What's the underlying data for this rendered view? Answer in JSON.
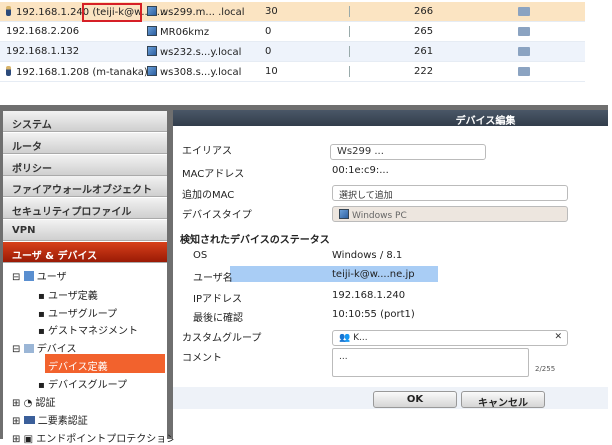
{
  "device_table": {
    "rows": [
      {
        "ip": "192.168.1.240",
        "user": "(teiji-k@w...o...",
        "user_icon": true,
        "host": "ws299.m... .local",
        "count1": "30",
        "count2": "266",
        "highlight": true
      },
      {
        "ip": "192.168.2.206",
        "user": "",
        "user_icon": false,
        "host": "MR06kmz",
        "count1": "0",
        "count2": "265"
      },
      {
        "ip": "192.168.1.132",
        "user": "",
        "user_icon": false,
        "host": "ws232.s...y.local",
        "count1": "0",
        "count2": "261"
      },
      {
        "ip": "192.168.1.208 (m-tanaka)",
        "user": "",
        "user_icon": true,
        "host": "ws308.s...y.local",
        "count1": "10",
        "count2": "222"
      }
    ]
  },
  "sidebar": {
    "menus": [
      "システム",
      "ルータ",
      "ポリシー",
      "ファイアウォールオブジェクト",
      "セキュリティプロファイル",
      "VPN",
      "ユーザ & デバイス"
    ],
    "tree": {
      "user": "ユーザ",
      "user_def": "ユーザ定義",
      "user_group": "ユーザグループ",
      "guest": "ゲストマネジメント",
      "device": "デバイス",
      "device_def": "デバイス定義",
      "device_group": "デバイスグループ",
      "auth": "認証",
      "two_factor": "二要素認証",
      "endpoint": "エンドポイントプロテクション"
    }
  },
  "dialog": {
    "title": "デバイス編集",
    "alias_label": "エイリアス",
    "alias_value": "Ws299 ...",
    "mac_label": "MACアドレス",
    "mac_value": "00:1e:c9:...",
    "addmac_label": "追加のMAC",
    "addmac_placeholder": "選択して追加",
    "type_label": "デバイスタイプ",
    "type_value": "Windows PC",
    "status_heading": "検知されたデバイスのステータス",
    "os_label": "OS",
    "os_value": "Windows / 8.1",
    "user_label": "ユーザ名",
    "user_value": "teiji-k@w....ne.jp",
    "ip_label": "IPアドレス",
    "ip_value": "192.168.1.240",
    "last_label": "最後に確認",
    "last_value": "10:10:55 (port1)",
    "group_label": "カスタムグループ",
    "group_value": "K...",
    "comment_label": "コメント",
    "comment_value": "...",
    "comment_count": "2/255",
    "ok": "OK",
    "cancel": "キャンセル"
  }
}
